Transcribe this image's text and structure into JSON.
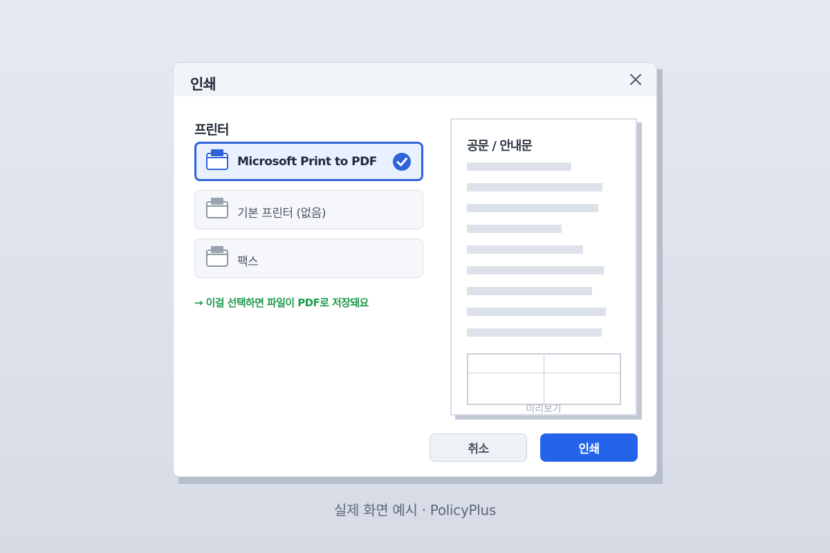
{
  "dialog": {
    "title": "인쇄",
    "close_icon": "close-icon"
  },
  "printers": {
    "section_label": "프린터",
    "items": [
      {
        "label": "Microsoft Print to PDF",
        "selected": true,
        "icon": "printer-icon"
      },
      {
        "label": "기본 프린터 (없음)",
        "selected": false,
        "icon": "printer-icon"
      },
      {
        "label": "팩스",
        "selected": false,
        "icon": "printer-icon"
      }
    ],
    "hint": "→ 이걸 선택하면 파일이 PDF로 저장돼요"
  },
  "preview": {
    "doc_title": "공문 / 안내문",
    "label": "미리보기"
  },
  "buttons": {
    "cancel": "취소",
    "print": "인쇄"
  },
  "footer": "실제 화면 예시 · PolicyPlus",
  "colors": {
    "accent": "#2563eb",
    "hint": "#1e9a4e",
    "selected_border": "#2f63d9"
  }
}
